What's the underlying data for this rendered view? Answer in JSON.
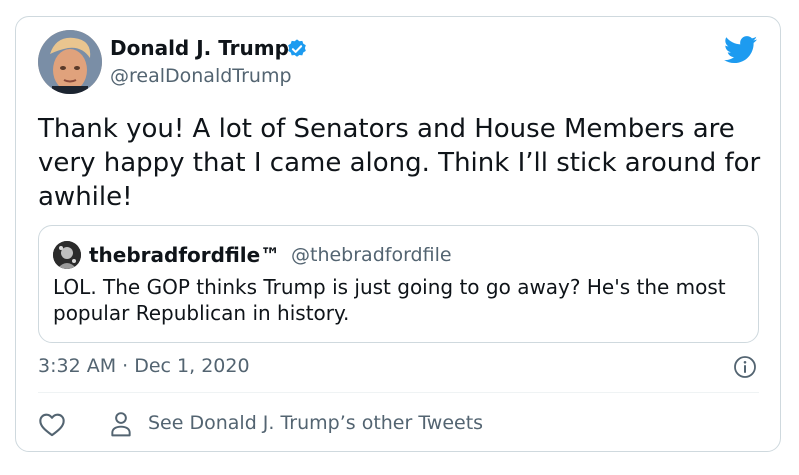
{
  "author": {
    "name": "Donald J. Trump",
    "handle": "@realDonaldTrump",
    "verified": true
  },
  "tweet": {
    "text": "Thank you! A lot of Senators and House Members are very happy that I came along. Think I’ll stick around for awhile!",
    "timestamp": "3:32 AM · Dec 1, 2020"
  },
  "quoted_tweet": {
    "name": "thebradfordfile™",
    "handle": "@thebradfordfile",
    "text": "LOL. The GOP thinks Trump is just going to go away? He's the most popular Republican in history."
  },
  "actions": {
    "other_tweets_label": "See Donald J. Trump’s other Tweets"
  },
  "icons": {
    "brand": "twitter-bird-icon",
    "verified": "verified-badge-icon",
    "info": "info-icon",
    "like": "heart-icon",
    "profile": "person-icon"
  },
  "colors": {
    "brand": "#1d9bf0",
    "text": "#0f1419",
    "secondary": "#536471",
    "border": "#cfd9de"
  }
}
